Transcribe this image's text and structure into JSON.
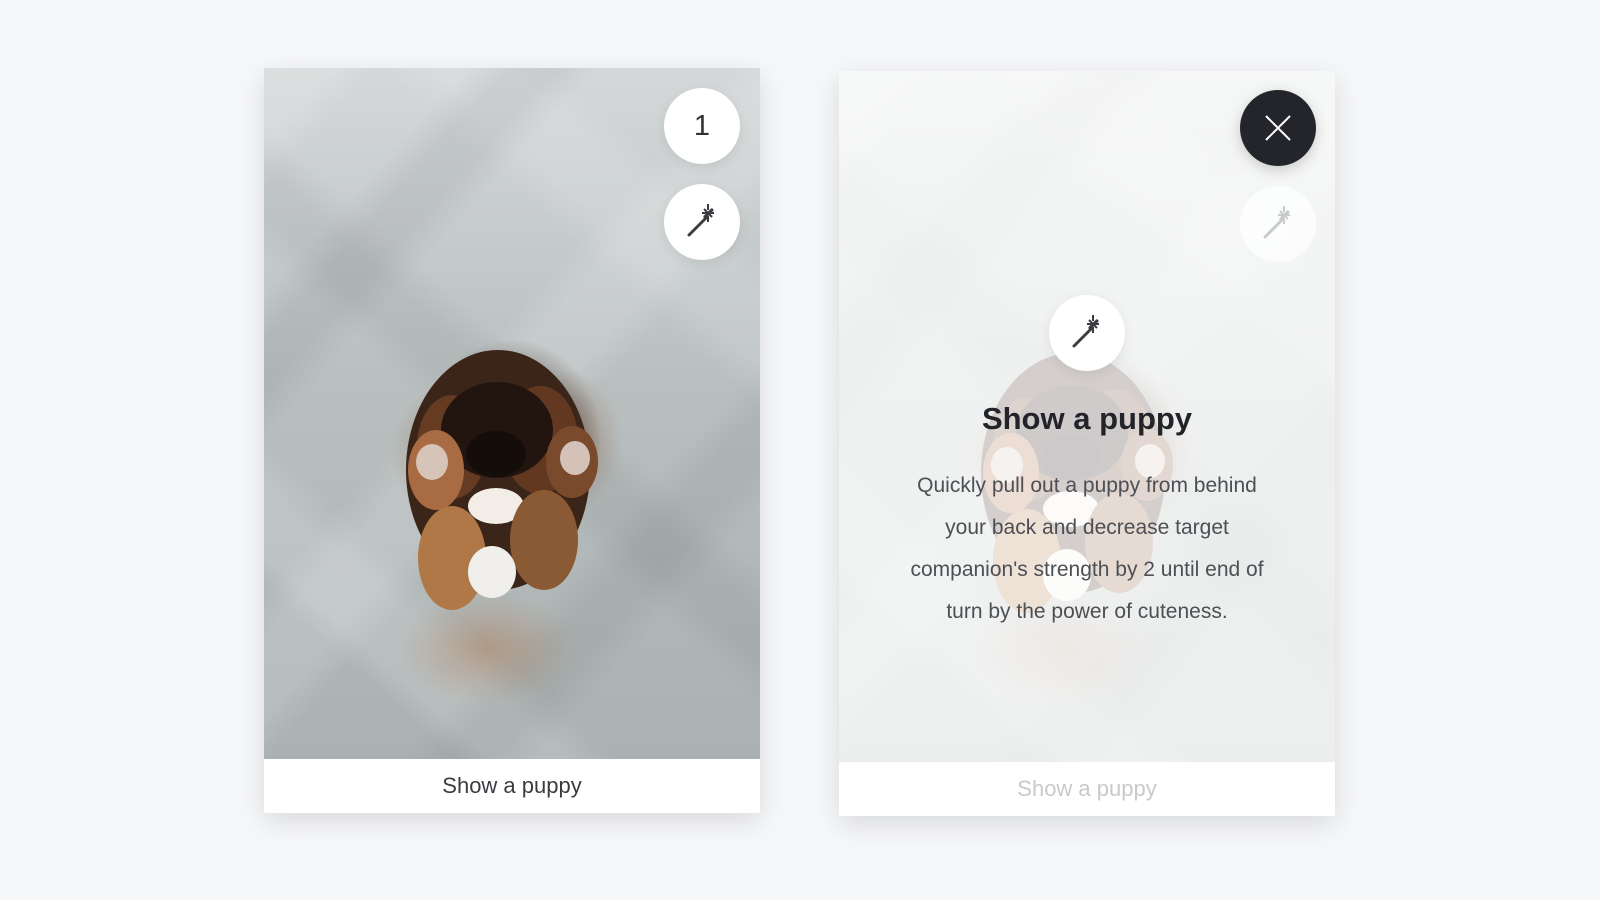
{
  "cards": {
    "left": {
      "count_badge": "1",
      "caption": "Show a puppy",
      "icons": {
        "magic": "magic-wand-icon"
      }
    },
    "right": {
      "caption": "Show a puppy",
      "details_title": "Show a puppy",
      "details_body": "Quickly pull out a puppy from behind\nyour back and decrease target\ncompanion's strength by 2 until end of\nturn by the power of cuteness.",
      "icons": {
        "close": "close-icon",
        "magic": "magic-wand-icon"
      }
    }
  },
  "colors": {
    "background": "#f6f7f9",
    "card": "#ffffff",
    "dark_button": "#24252a",
    "text_primary": "#222429",
    "text_secondary": "#4d4f54",
    "caption_muted": "#c7c9cc"
  }
}
